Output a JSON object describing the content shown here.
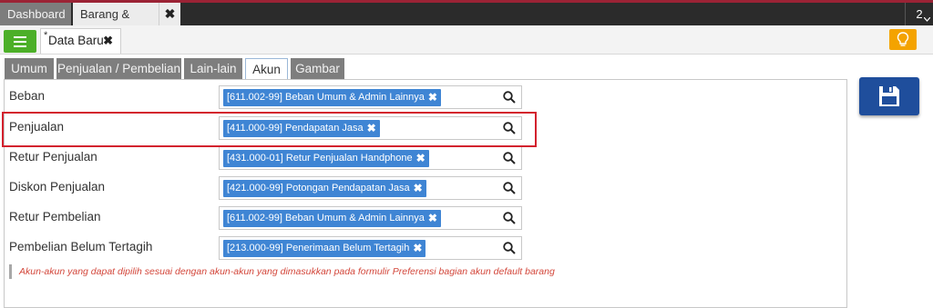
{
  "top_tabs": {
    "dashboard": "Dashboard",
    "barang_jasa": "Barang & Jasa",
    "close_symbol": "✖",
    "badge": "2"
  },
  "doc_tab": {
    "modified_mark": "*",
    "title": "Data Baru",
    "close_symbol": "✖"
  },
  "sub_tabs": [
    "Umum",
    "Penjualan / Pembelian",
    "Lain-lain",
    "Akun",
    "Gambar"
  ],
  "active_sub_tab": "Akun",
  "rows": [
    {
      "label": "Beban",
      "value": "[611.002-99] Beban Umum & Admin Lainnya"
    },
    {
      "label": "Penjualan",
      "value": "[411.000-99] Pendapatan Jasa"
    },
    {
      "label": "Retur Penjualan",
      "value": "[431.000-01] Retur Penjualan Handphone"
    },
    {
      "label": "Diskon Penjualan",
      "value": "[421.000-99] Potongan Pendapatan Jasa"
    },
    {
      "label": "Retur Pembelian",
      "value": "[611.002-99] Beban Umum & Admin Lainnya"
    },
    {
      "label": "Pembelian Belum Tertagih",
      "value": "[213.000-99] Penerimaan Belum Tertagih"
    }
  ],
  "chip_remove_symbol": "✖",
  "note": "Akun-akun yang dapat dipilih sesuai dengan akun-akun yang dimasukkan pada formulir Preferensi bagian akun default barang",
  "highlighted_row": "Penjualan",
  "colors": {
    "accent_red_strip": "#9b2335",
    "menu_green": "#4caf28",
    "chip_blue": "#3f85d4",
    "save_blue": "#1f4e9c",
    "bulb_orange": "#f4a300",
    "highlight_red": "#d3212d",
    "note_red": "#d3473b"
  },
  "icons": {
    "menu": "list-icon",
    "bulb": "lightbulb-icon",
    "save": "floppy-disk-icon",
    "search": "magnifier-icon",
    "dropdown": "chevron-down-icon"
  }
}
